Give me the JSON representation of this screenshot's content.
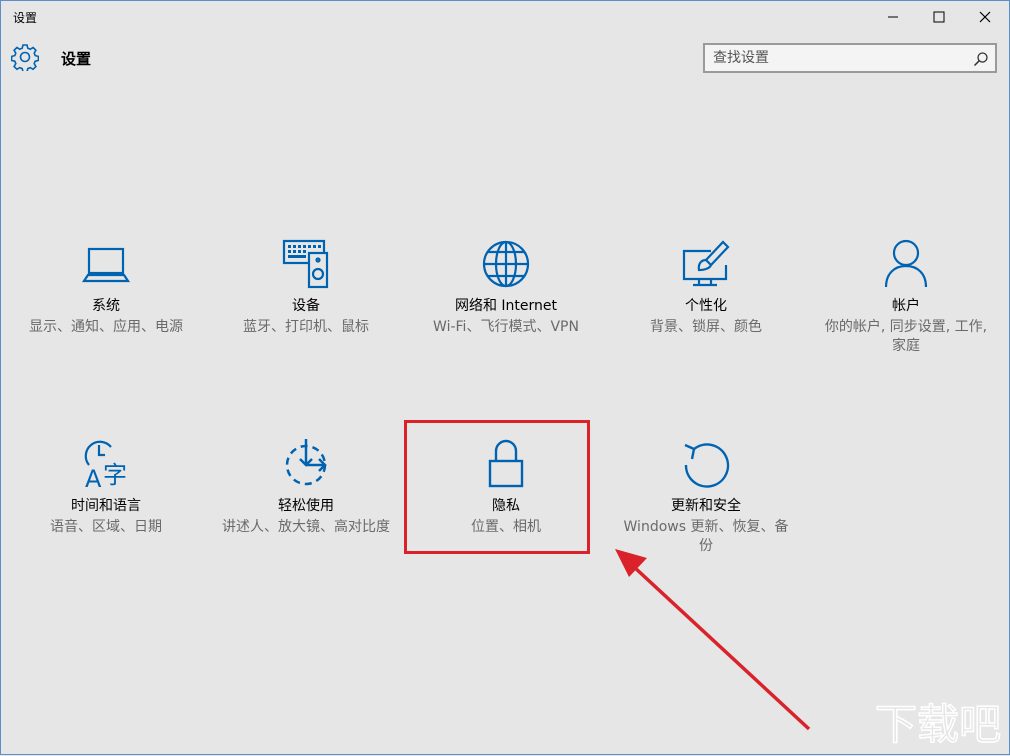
{
  "window": {
    "title": "设置",
    "controls": [
      "minimize-icon",
      "maximize-icon",
      "close-icon"
    ]
  },
  "header": {
    "icon": "gear-icon",
    "title": "设置",
    "search_placeholder": "查找设置",
    "search_icon": "search-icon"
  },
  "tiles": [
    {
      "icon": "laptop-icon",
      "name": "系统",
      "desc": "显示、通知、应用、电源"
    },
    {
      "icon": "devices-icon",
      "name": "设备",
      "desc": "蓝牙、打印机、鼠标"
    },
    {
      "icon": "globe-icon",
      "name": "网络和 Internet",
      "desc": "Wi-Fi、飞行模式、VPN"
    },
    {
      "icon": "personalization-icon",
      "name": "个性化",
      "desc": "背景、锁屏、颜色"
    },
    {
      "icon": "person-icon",
      "name": "帐户",
      "desc": "你的帐户, 同步设置, 工作, 家庭"
    },
    {
      "icon": "time-language-icon",
      "name": "时间和语言",
      "desc": "语音、区域、日期"
    },
    {
      "icon": "ease-of-access-icon",
      "name": "轻松使用",
      "desc": "讲述人、放大镜、高对比度"
    },
    {
      "icon": "lock-icon",
      "name": "隐私",
      "desc": "位置、相机"
    },
    {
      "icon": "update-icon",
      "name": "更新和安全",
      "desc": "Windows 更新、恢复、备份"
    }
  ],
  "annotation": {
    "highlight_color": "#d9222a",
    "arrow_color": "#d9222a"
  },
  "colors": {
    "accent": "#0063b1",
    "background": "#e6e6e6"
  },
  "watermark": {
    "text": "下载吧"
  }
}
